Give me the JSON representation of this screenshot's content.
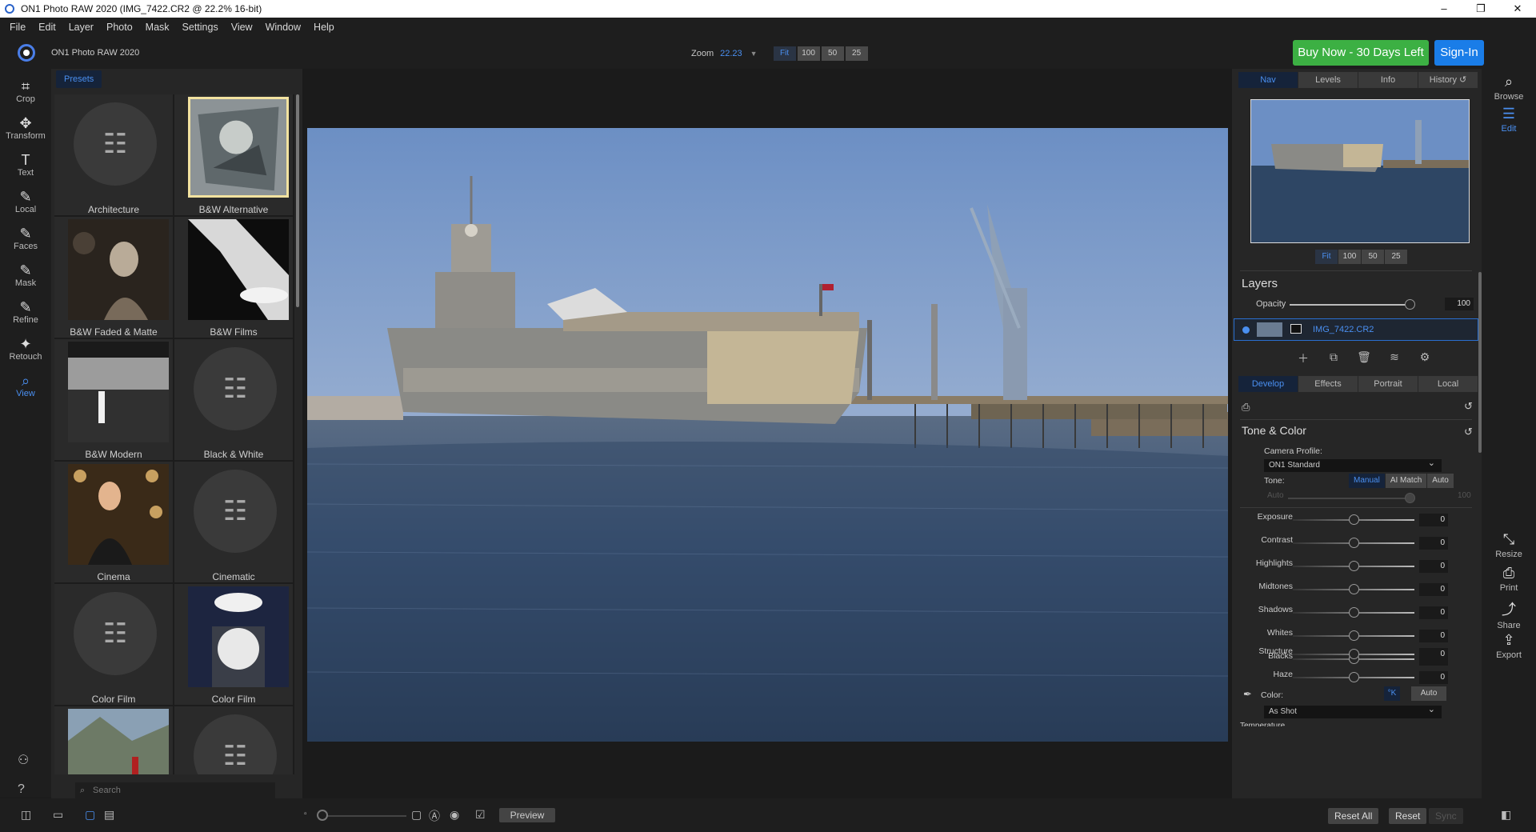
{
  "window": {
    "title": "ON1 Photo RAW 2020 (IMG_7422.CR2 @ 22.2% 16-bit)",
    "min": "–",
    "max": "❐",
    "close": "✕"
  },
  "menu": [
    "File",
    "Edit",
    "Layer",
    "Photo",
    "Mask",
    "Settings",
    "View",
    "Window",
    "Help"
  ],
  "topbar": {
    "app_name": "ON1 Photo RAW 2020",
    "zoom_label": "Zoom",
    "zoom_value": "22.23",
    "zoom_buttons": [
      "Fit",
      "100",
      "50",
      "25"
    ],
    "buy_now": "Buy Now - 30 Days Left",
    "sign_in": "Sign-In"
  },
  "tools": [
    {
      "label": "Crop",
      "icon": "crop-icon",
      "glyph": "⌗"
    },
    {
      "label": "Transform",
      "icon": "move-icon",
      "glyph": "✥"
    },
    {
      "label": "Text",
      "icon": "text-icon",
      "glyph": "T"
    },
    {
      "label": "Local",
      "icon": "brush-icon",
      "glyph": "✎"
    },
    {
      "label": "Faces",
      "icon": "face-brush-icon",
      "glyph": "✎"
    },
    {
      "label": "Mask",
      "icon": "mask-brush-icon",
      "glyph": "✎"
    },
    {
      "label": "Refine",
      "icon": "refine-brush-icon",
      "glyph": "✎"
    },
    {
      "label": "Retouch",
      "icon": "retouch-icon",
      "glyph": "✦"
    },
    {
      "label": "View",
      "icon": "view-zoom-icon",
      "glyph": "⌕"
    }
  ],
  "presets": {
    "tab": "Presets",
    "search_placeholder": "Search",
    "items": [
      {
        "label": "Architecture",
        "thumb": "none"
      },
      {
        "label": "B&W Alternative",
        "thumb": "bwalt"
      },
      {
        "label": "B&W Faded & Matte",
        "thumb": "bwfaded"
      },
      {
        "label": "B&W Films",
        "thumb": "bwfilms"
      },
      {
        "label": "B&W Modern",
        "thumb": "bwmodern"
      },
      {
        "label": "Black & White",
        "thumb": "none"
      },
      {
        "label": "Cinema",
        "thumb": "cinema"
      },
      {
        "label": "Cinematic",
        "thumb": "none"
      },
      {
        "label": "Color Film",
        "thumb": "none"
      },
      {
        "label": "Color Film",
        "thumb": "colorfilm"
      },
      {
        "label": "",
        "thumb": "landscape"
      },
      {
        "label": "",
        "thumb": "none"
      }
    ]
  },
  "bottom": {
    "preview": "Preview",
    "reset_all": "Reset All",
    "reset": "Reset",
    "sync": "Sync"
  },
  "right": {
    "tabs": [
      "Nav",
      "Levels",
      "Info",
      "History ↺"
    ],
    "nav_buttons": [
      "Fit",
      "100",
      "50",
      "25"
    ],
    "layers_title": "Layers",
    "opacity_label": "Opacity",
    "opacity_value": "100",
    "layer_name": "IMG_7422.CR2",
    "develop_tabs": [
      "Develop",
      "Effects",
      "Portrait",
      "Local"
    ],
    "tone_color_title": "Tone & Color",
    "camera_profile_label": "Camera Profile:",
    "camera_profile_value": "ON1 Standard",
    "tone_label": "Tone:",
    "tone_modes": [
      "Manual",
      "AI Match",
      "Auto"
    ],
    "auto_label": "Auto",
    "auto_value": "100",
    "sliders": [
      {
        "label": "Exposure",
        "value": "0"
      },
      {
        "label": "Contrast",
        "value": "0"
      },
      {
        "label": "Highlights",
        "value": "0"
      },
      {
        "label": "Midtones",
        "value": "0"
      },
      {
        "label": "Shadows",
        "value": "0"
      },
      {
        "label": "Whites",
        "value": "0"
      },
      {
        "label": "Blacks",
        "value": "0"
      }
    ],
    "sliders2": [
      {
        "label": "Structure",
        "value": "0"
      },
      {
        "label": "Haze",
        "value": "0"
      }
    ],
    "color_label": "Color:",
    "color_k": "°K",
    "color_auto": "Auto",
    "wb_value": "As Shot",
    "temperature_label": "Temperature"
  },
  "farright": [
    {
      "label": "Browse"
    },
    {
      "label": "Edit"
    },
    {
      "label": "Resize"
    },
    {
      "label": "Print"
    },
    {
      "label": "Share"
    },
    {
      "label": "Export"
    }
  ]
}
